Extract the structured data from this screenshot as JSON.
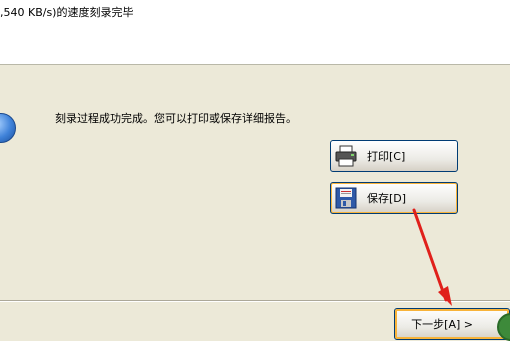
{
  "status": {
    "text": ",540 KB/s)的速度刻录完毕"
  },
  "message": {
    "text": "刻录过程成功完成。您可以打印或保存详细报告。"
  },
  "buttons": {
    "print_label": "打印[C]",
    "save_label": "保存[D]",
    "next_label": "下一步[A] >"
  },
  "icons": {
    "info": "info-icon",
    "print": "printer-icon",
    "save": "floppy-disk-icon"
  },
  "colors": {
    "window_bg": "#ece9d8",
    "button_border": "#003c74",
    "focus_ring": "#f8b33a",
    "annotation_arrow": "#e0201b"
  }
}
